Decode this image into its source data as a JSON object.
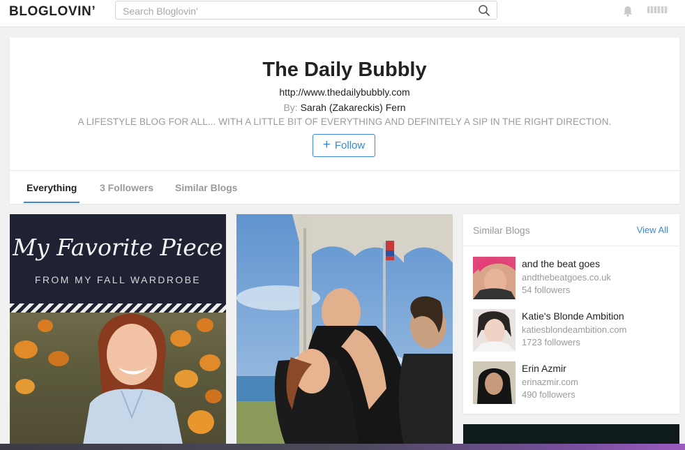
{
  "topbar": {
    "logo": "BLOGLOVIN’",
    "search_placeholder": "Search Bloglovin'",
    "icons": [
      "search-icon",
      "bell-icon"
    ]
  },
  "blog": {
    "title": "The Daily Bubbly",
    "url": "http://www.thedailybubbly.com",
    "author_prefix": "By:",
    "author_name": "Sarah (Zakareckis) Fern",
    "description": "A LIFESTYLE BLOG FOR ALL... WITH A LITTLE BIT OF EVERYTHING AND DEFINITELY A SIP IN THE RIGHT DIRECTION.",
    "follow_label": "Follow"
  },
  "tabs": [
    {
      "label": "Everything",
      "active": true
    },
    {
      "label": "3 Followers",
      "active": false
    },
    {
      "label": "Similar Blogs",
      "active": false
    }
  ],
  "posts": [
    {
      "title": "My Favorite Piece",
      "subtitle": "FROM MY FALL WARDROBE"
    },
    {
      "title": ""
    }
  ],
  "similar_blogs": {
    "title": "Similar Blogs",
    "view_all": "View All",
    "items": [
      {
        "name": "and the beat goes",
        "url": "andthebeatgoes.co.uk",
        "followers": "54 followers"
      },
      {
        "name": "Katie's Blonde Ambition",
        "url": "katiesblondeambition.com",
        "followers": "1723 followers"
      },
      {
        "name": "Erin Azmir",
        "url": "erinazmir.com",
        "followers": "490 followers"
      }
    ]
  },
  "colors": {
    "accent": "#3a87d6",
    "muted_text": "#9a9a9a",
    "post1_bg": "#1f2233"
  }
}
